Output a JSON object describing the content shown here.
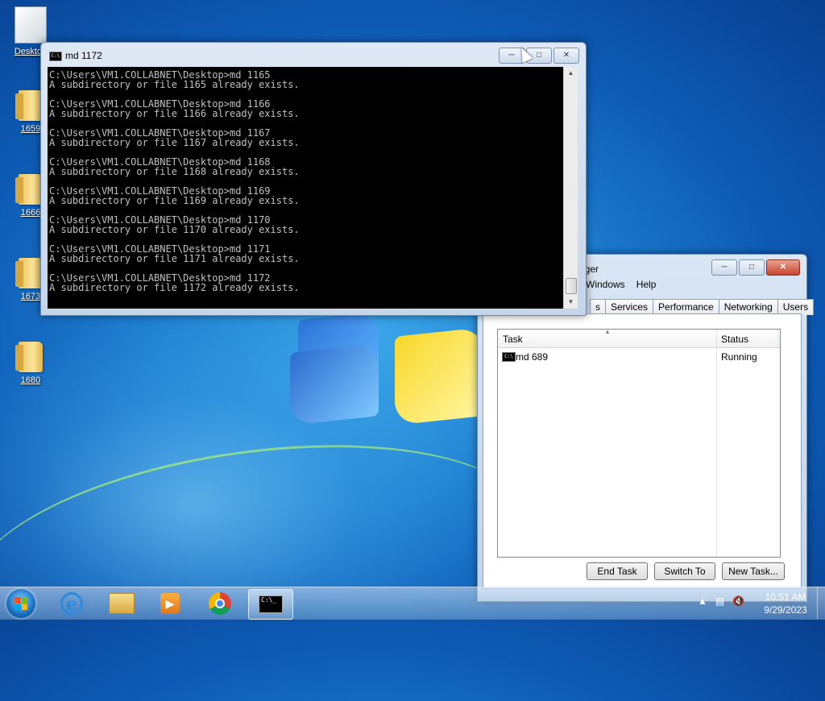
{
  "desktop": {
    "icons": [
      {
        "label": "Desktop",
        "kind": "documents"
      },
      {
        "label": "1659",
        "kind": "folder"
      },
      {
        "label": "1666",
        "kind": "folder"
      },
      {
        "label": "1673",
        "kind": "folder"
      },
      {
        "label": "1680",
        "kind": "folder"
      }
    ]
  },
  "console_window": {
    "title": "md  1172",
    "icon_text": "C:\\",
    "lines": [
      "C:\\Users\\VM1.COLLABNET\\Desktop>md 1165",
      "A subdirectory or file 1165 already exists.",
      "",
      "C:\\Users\\VM1.COLLABNET\\Desktop>md 1166",
      "A subdirectory or file 1166 already exists.",
      "",
      "C:\\Users\\VM1.COLLABNET\\Desktop>md 1167",
      "A subdirectory or file 1167 already exists.",
      "",
      "C:\\Users\\VM1.COLLABNET\\Desktop>md 1168",
      "A subdirectory or file 1168 already exists.",
      "",
      "C:\\Users\\VM1.COLLABNET\\Desktop>md 1169",
      "A subdirectory or file 1169 already exists.",
      "",
      "C:\\Users\\VM1.COLLABNET\\Desktop>md 1170",
      "A subdirectory or file 1170 already exists.",
      "",
      "C:\\Users\\VM1.COLLABNET\\Desktop>md 1171",
      "A subdirectory or file 1171 already exists.",
      "",
      "C:\\Users\\VM1.COLLABNET\\Desktop>md 1172",
      "A subdirectory or file 1172 already exists."
    ]
  },
  "task_manager": {
    "title_visible": "ager",
    "menu": [
      "Windows",
      "Help"
    ],
    "tabs": [
      "s",
      "Services",
      "Performance",
      "Networking",
      "Users"
    ],
    "columns": {
      "task": "Task",
      "status": "Status"
    },
    "rows": [
      {
        "icon_text": "C:\\",
        "task": "md  689",
        "status": "Running"
      }
    ],
    "buttons": {
      "end_task": "End Task",
      "switch_to": "Switch To",
      "new_task": "New Task..."
    }
  },
  "taskbar": {
    "cmd_icon_text": "C:\\_",
    "clock": {
      "time": "10:51 AM",
      "date": "9/29/2023"
    }
  },
  "colors": {
    "close_button": "#c8452e",
    "console_bg": "#000000",
    "console_text": "#c0c0c0"
  }
}
